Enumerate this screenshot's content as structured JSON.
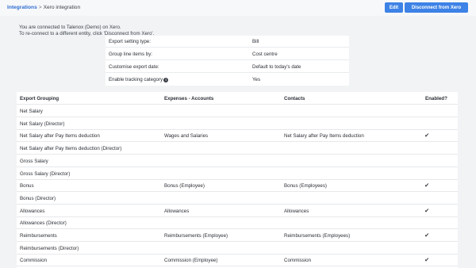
{
  "breadcrumb": {
    "link": "Integrations",
    "separator": ">",
    "current": "Xero integration"
  },
  "actions": {
    "edit": "Edit",
    "disconnect": "Disconnect from Xero"
  },
  "intro": {
    "line1": "You are connected to Talenox (Demo) on Xero.",
    "line2": "To re-connect to a different entity, click 'Disconnect from Xero'."
  },
  "settings": [
    {
      "label": "Export setting type:",
      "value": "Bill"
    },
    {
      "label": "Group line items by:",
      "value": "Cost centre"
    },
    {
      "label": "Customise export date:",
      "value": "Default to today's date"
    },
    {
      "label": "Enable tracking category",
      "value": "Yes",
      "icon": "info-icon"
    }
  ],
  "table": {
    "headers": {
      "grouping": "Export Grouping",
      "expenses": "Expenses - Accounts",
      "contacts": "Contacts",
      "enabled": "Enabled?"
    },
    "rows": [
      {
        "grouping": "Net Salary",
        "expenses": "",
        "contacts": "",
        "enabled": false
      },
      {
        "grouping": "Net Salary (Director)",
        "expenses": "",
        "contacts": "",
        "enabled": false
      },
      {
        "grouping": "Net Salary after Pay Items deduction",
        "expenses": "Wages and Salaries",
        "contacts": "Net Salary after Pay Items deduction",
        "enabled": true
      },
      {
        "grouping": "Net Salary after Pay Items deduction (Director)",
        "expenses": "",
        "contacts": "",
        "enabled": false
      },
      {
        "grouping": "Gross Salary",
        "expenses": "",
        "contacts": "",
        "enabled": false
      },
      {
        "grouping": "Gross Salary (Director)",
        "expenses": "",
        "contacts": "",
        "enabled": false
      },
      {
        "grouping": "Bonus",
        "expenses": "Bonus (Employee)",
        "contacts": "Bonus (Employees)",
        "enabled": true
      },
      {
        "grouping": "Bonus (Director)",
        "expenses": "",
        "contacts": "",
        "enabled": false
      },
      {
        "grouping": "Allowances",
        "expenses": "Allowances",
        "contacts": "Allowances",
        "enabled": true
      },
      {
        "grouping": "Allowances (Director)",
        "expenses": "",
        "contacts": "",
        "enabled": false
      },
      {
        "grouping": "Reimbursements",
        "expenses": "Reimbursements (Employee)",
        "contacts": "Reimbursements (Employees)",
        "enabled": true
      },
      {
        "grouping": "Reimbursements (Director)",
        "expenses": "",
        "contacts": "",
        "enabled": false
      },
      {
        "grouping": "Commission",
        "expenses": "Commission (Employee)",
        "contacts": "Commission",
        "enabled": true
      }
    ],
    "check_glyph": "✔"
  }
}
